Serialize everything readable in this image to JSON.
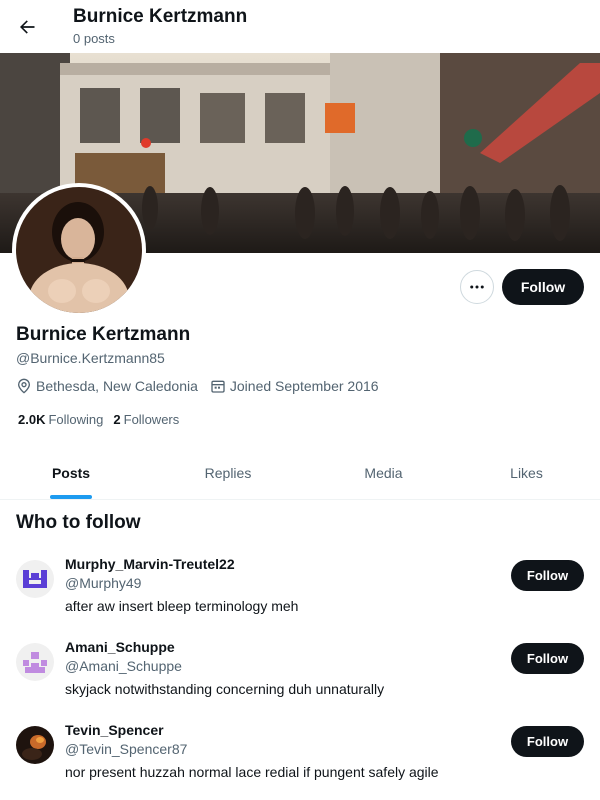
{
  "header": {
    "back_icon": "arrow-left-icon",
    "title": "Burnice Kertzmann",
    "subtitle": "0 posts"
  },
  "profile": {
    "name": "Burnice Kertzmann",
    "handle": "@Burnice.Kertzmann85",
    "location": "Bethesda, New Caledonia",
    "joined": "Joined September 2016",
    "following_count": "2.0K",
    "following_label": "Following",
    "followers_count": "2",
    "followers_label": "Followers",
    "follow_label": "Follow",
    "more_icon": "more-horizontal-icon"
  },
  "tabs": [
    {
      "label": "Posts",
      "active": true
    },
    {
      "label": "Replies",
      "active": false
    },
    {
      "label": "Media",
      "active": false
    },
    {
      "label": "Likes",
      "active": false
    }
  ],
  "who_to_follow": {
    "title": "Who to follow",
    "items": [
      {
        "name": "Murphy_Marvin-Treutel22",
        "handle": "@Murphy49",
        "bio": "after aw insert bleep terminology meh",
        "follow_label": "Follow",
        "avatar_color": "#5b3fd6"
      },
      {
        "name": "Amani_Schuppe",
        "handle": "@Amani_Schuppe",
        "bio": "skyjack notwithstanding concerning duh unnaturally",
        "follow_label": "Follow",
        "avatar_color": "#c08be0"
      },
      {
        "name": "Tevin_Spencer",
        "handle": "@Tevin_Spencer87",
        "bio": "nor present huzzah normal lace redial if pungent safely agile",
        "follow_label": "Follow",
        "avatar_color": "#2a1b14"
      }
    ]
  },
  "colors": {
    "accent": "#1d9bf0",
    "text_primary": "#0f1419",
    "text_secondary": "#536471",
    "button_dark": "#0f1419"
  }
}
